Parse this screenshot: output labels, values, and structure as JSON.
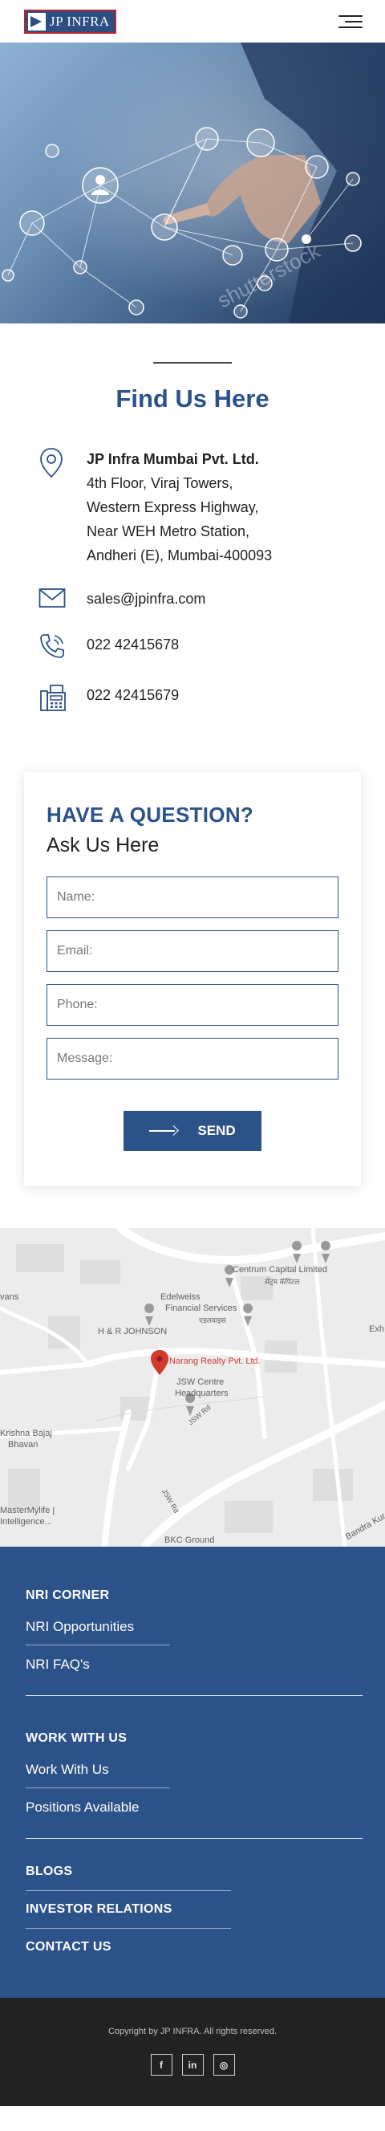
{
  "header": {
    "logo_text": "JP INFRA",
    "menu_icon": "hamburger-menu-icon"
  },
  "hero": {
    "image_alt": "hand touching network",
    "watermark": "shutterstock"
  },
  "find_us": {
    "title": "Find Us Here",
    "address": {
      "company": "JP Infra Mumbai Pvt. Ltd.",
      "line1": "4th Floor, Viraj Towers,",
      "line2": "Western Express Highway,",
      "line3": "Near WEH Metro Station,",
      "line4": "Andheri (E), Mumbai-400093"
    },
    "email": "sales@jpinfra.com",
    "phone": "022 42415678",
    "fax": "022 42415679"
  },
  "form": {
    "title": "HAVE A QUESTION?",
    "subtitle": "Ask Us Here",
    "name_placeholder": "Name:",
    "email_placeholder": "Email:",
    "phone_placeholder": "Phone:",
    "message_placeholder": "Message:",
    "send_label": "SEND"
  },
  "map": {
    "labels": {
      "centrum": "Centrum Capital Limited",
      "centrum_local": "सेंट्रम कॅपिटल",
      "edelweiss1": "Edelweiss",
      "edelweiss2": "Financial Services",
      "edelweiss_local": "एडलवाइस",
      "hr": "H & R JOHNSON",
      "narang": "Narang Realty Pvt. Ltd.",
      "jsw1": "JSW Centre",
      "jsw2": "Headquarters",
      "krishna1": "Krishna Bajaj",
      "krishna2": "Bhavan",
      "mastermylife1": "MasterMylife |",
      "mastermylife2": "Intelligence...",
      "vans": "vans",
      "exh": "Exh",
      "bkc": "BKC Ground",
      "bandra": "Bandra Kur",
      "road1": "JSW Rd",
      "road2": "JSW Rd"
    }
  },
  "footer": {
    "nri_head": "NRI CORNER",
    "nri_opps": "NRI Opportunities",
    "nri_faq": "NRI FAQ's",
    "work_head": "WORK WITH US",
    "work_link": "Work With Us",
    "positions": "Positions Available",
    "blogs": "BLOGS",
    "investor": "INVESTOR RELATIONS",
    "contact": "CONTACT US",
    "copyright": "Copyright by JP INFRA. All rights reserved.",
    "social": {
      "facebook": "f",
      "linkedin": "in",
      "instagram": "◎"
    }
  },
  "colors": {
    "brand_blue": "#2c528a",
    "logo_red": "#b8232f",
    "footer_dark": "#222222",
    "map_pin_red": "#d33a2c"
  }
}
